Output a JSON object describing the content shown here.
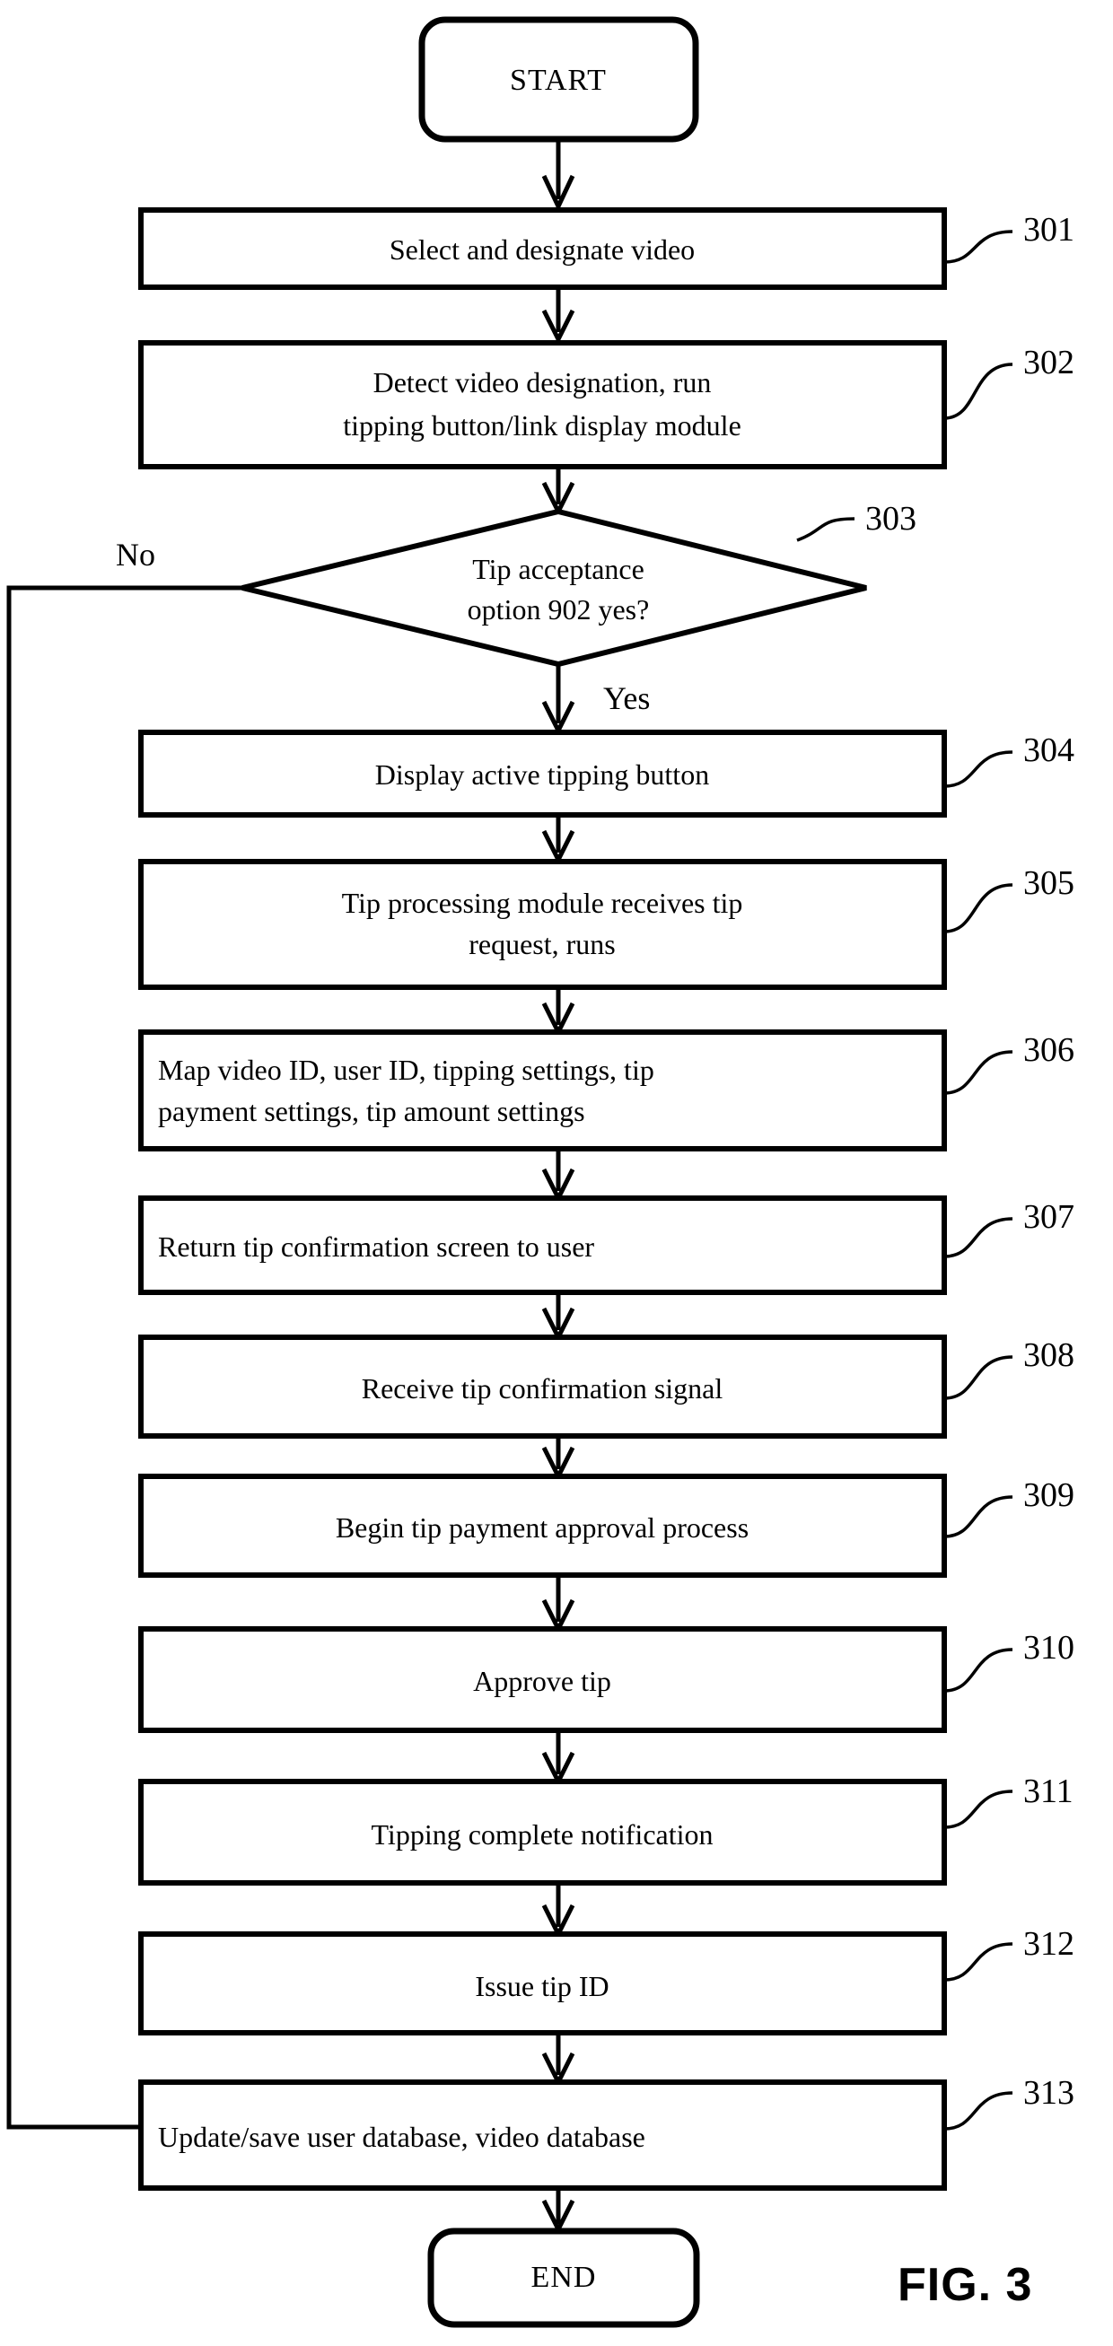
{
  "figure": {
    "label": "FIG. 3",
    "type": "flowchart"
  },
  "terminals": {
    "start": "START",
    "end": "END"
  },
  "branches": {
    "no": "No",
    "yes": "Yes"
  },
  "decision": {
    "ref": "303",
    "line1": "Tip acceptance",
    "line2": "option 902 yes?"
  },
  "steps": [
    {
      "ref": "301",
      "align": "center",
      "lines": [
        "Select and designate video"
      ]
    },
    {
      "ref": "302",
      "align": "center",
      "lines": [
        "Detect video designation, run",
        "tipping button/link display  module"
      ]
    },
    {
      "ref": "304",
      "align": "center",
      "lines": [
        "Display active tipping button"
      ]
    },
    {
      "ref": "305",
      "align": "center",
      "lines": [
        "Tip processing module receives tip",
        "request, runs"
      ]
    },
    {
      "ref": "306",
      "align": "left",
      "lines": [
        "Map video ID, user ID, tipping  settings, tip",
        "payment  settings,  tip amount settings"
      ]
    },
    {
      "ref": "307",
      "align": "left",
      "lines": [
        "Return tip confirmation screen to user"
      ]
    },
    {
      "ref": "308",
      "align": "center",
      "lines": [
        "Receive tip confirmation signal"
      ]
    },
    {
      "ref": "309",
      "align": "center",
      "lines": [
        "Begin tip payment approval process"
      ]
    },
    {
      "ref": "310",
      "align": "center",
      "lines": [
        "Approve tip"
      ]
    },
    {
      "ref": "311",
      "align": "center",
      "lines": [
        "Tipping complete notification"
      ]
    },
    {
      "ref": "312",
      "align": "center",
      "lines": [
        "Issue tip ID"
      ]
    },
    {
      "ref": "313",
      "align": "left",
      "lines": [
        "Update/save user database, video  database"
      ]
    }
  ],
  "colors": {
    "stroke": "#000000",
    "fill": "#ffffff"
  }
}
